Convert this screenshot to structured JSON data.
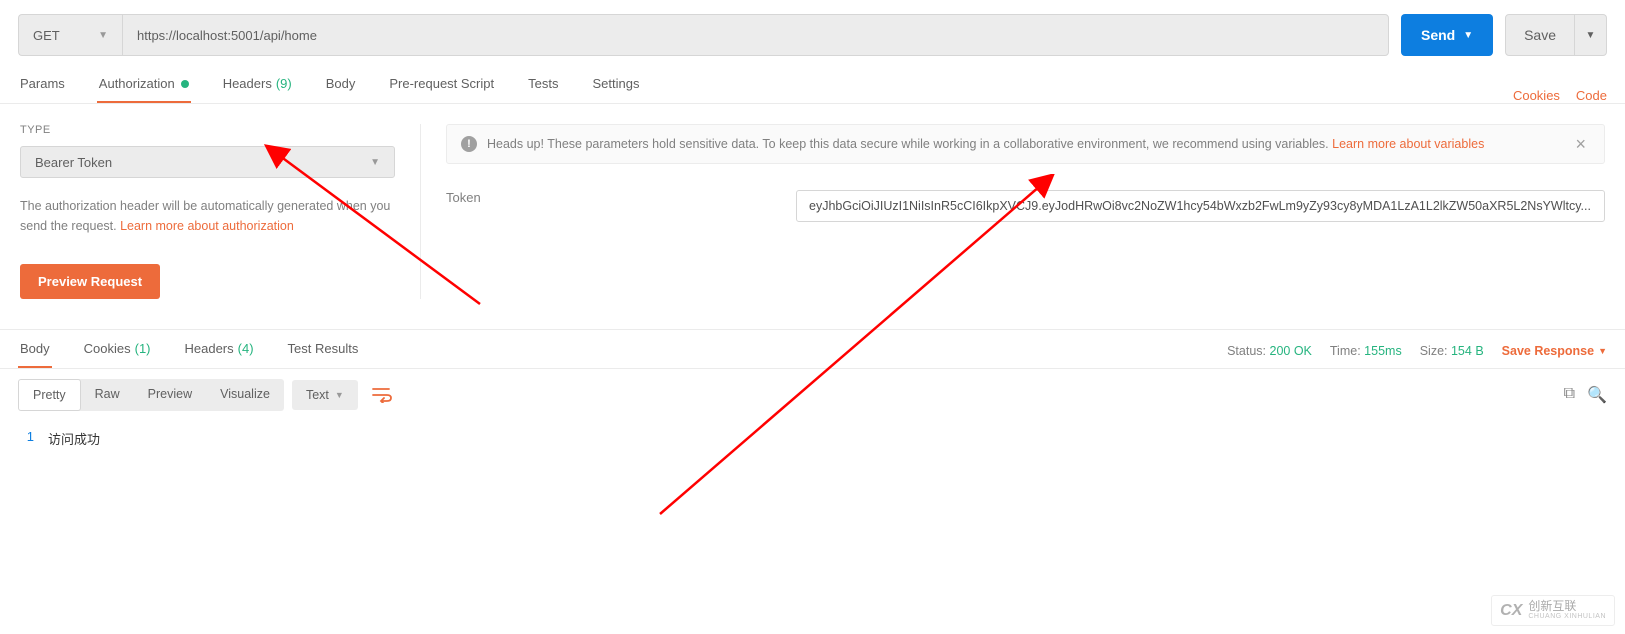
{
  "request": {
    "method": "GET",
    "url": "https://localhost:5001/api/home",
    "send": "Send",
    "save": "Save"
  },
  "tabs": {
    "params": "Params",
    "auth": "Authorization",
    "headers": "Headers",
    "headers_count": "(9)",
    "body": "Body",
    "prerequest": "Pre-request Script",
    "tests": "Tests",
    "settings": "Settings",
    "cookies": "Cookies",
    "code": "Code"
  },
  "auth": {
    "type_label": "TYPE",
    "type_value": "Bearer Token",
    "desc1": "The authorization header will be automatically generated when you send the request. ",
    "desc_link": "Learn more about authorization",
    "preview": "Preview Request",
    "alert_text": "Heads up! These parameters hold sensitive data. To keep this data secure while working in a collaborative environment, we recommend using variables. ",
    "alert_link": "Learn more about variables",
    "token_label": "Token",
    "token_value": "eyJhbGciOiJIUzI1NiIsInR5cCI6IkpXVCJ9.eyJodHRwOi8vc2NoZW1hcy54bWxzb2FwLm9yZy93cy8yMDA1LzA1L2lkZW50aXR5L2NsYWltcy..."
  },
  "response": {
    "tabs": {
      "body": "Body",
      "cookies": "Cookies",
      "cookies_count": "(1)",
      "headers": "Headers",
      "headers_count": "(4)",
      "tests": "Test Results"
    },
    "status_label": "Status:",
    "status_value": "200 OK",
    "time_label": "Time:",
    "time_value": "155ms",
    "size_label": "Size:",
    "size_value": "154 B",
    "save_response": "Save Response",
    "toolbar": {
      "pretty": "Pretty",
      "raw": "Raw",
      "preview": "Preview",
      "visualize": "Visualize",
      "format": "Text"
    },
    "lines": [
      {
        "n": "1",
        "text": "访问成功"
      }
    ]
  },
  "watermark": {
    "logo": "CX",
    "text": "创新互联",
    "sub": "CHUANG XINHULIAN"
  }
}
